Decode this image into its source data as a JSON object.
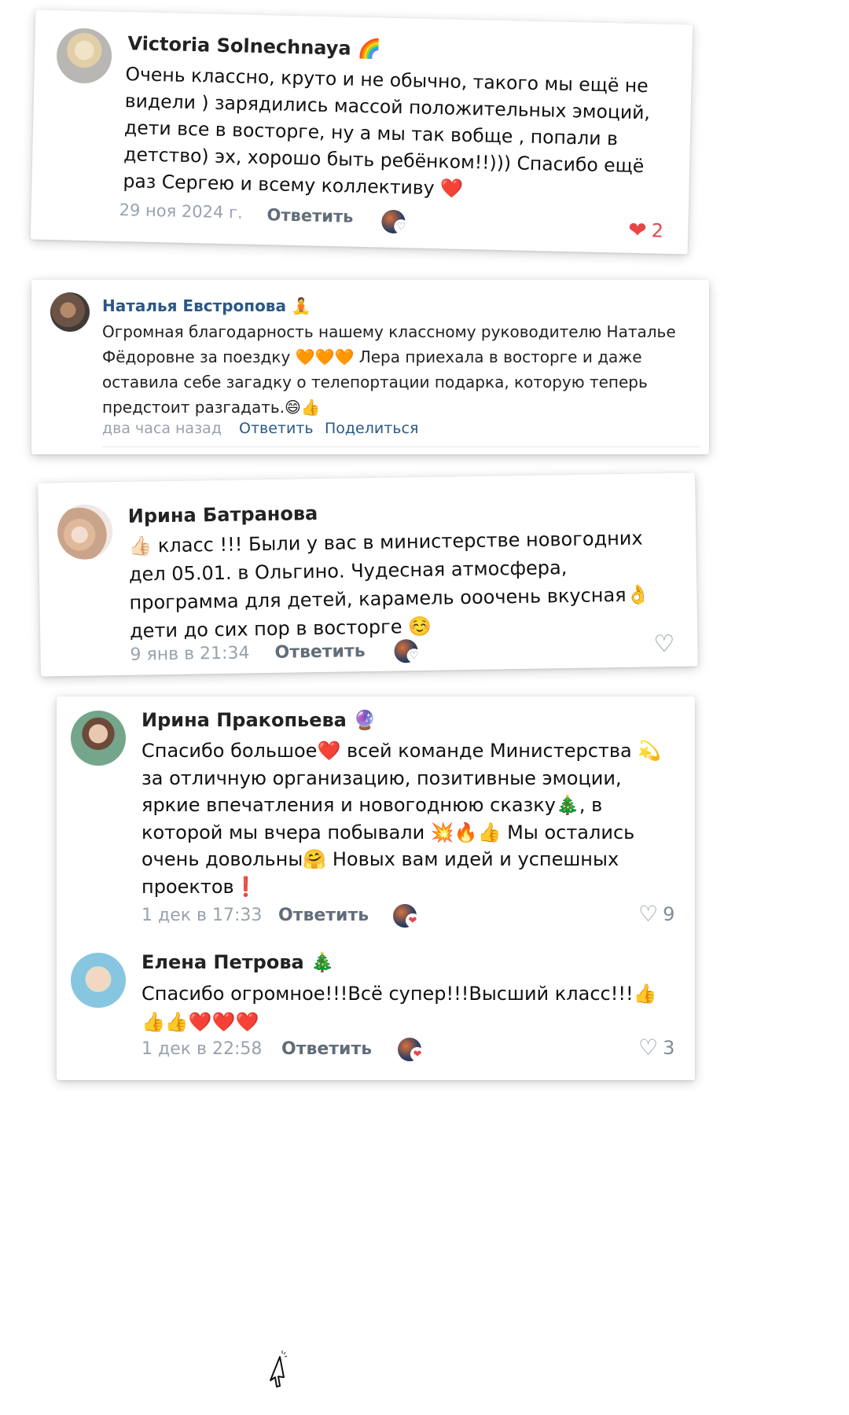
{
  "colors": {
    "like_red": "#e64646",
    "meta_gray": "#99a2ad",
    "link_blue": "#2a5885"
  },
  "comments": [
    {
      "author": "Victoria Solnechnaya 🌈",
      "text": "Очень классно, круто и не обычно,  такого мы ещё не видели ) зарядились массой положительных эмоций, дети все в восторге, ну а мы так вобще , попали в детство) эх, хорошо быть ребёнком!!))) Спасибо ещё раз Сергею и всему коллективу ❤️",
      "date": "29 ноя 2024 г.",
      "reply_label": "Ответить",
      "likes": "2",
      "liked": true
    },
    {
      "author": "Наталья Евстропова 🧘",
      "text": "Огромная благодарность нашему классному руководителю Наталье Фёдоровне за поездку 🧡🧡🧡 Лера приехала в восторге и даже оставила себе загадку о телепортации подарка, которую теперь предстоит разгадать.😄👍",
      "date": "два часа назад",
      "reply_label": "Ответить",
      "share_label": "Поделиться"
    },
    {
      "author": "Ирина Батранова",
      "text": "👍🏻 класс !!! Были у вас в министерстве новогодних дел 05.01. в Ольгино. Чудесная атмосфера, программа для детей, карамель ооочень вкусная👌 дети до сих пор в восторге ☺️",
      "date": "9 янв в 21:34",
      "reply_label": "Ответить"
    },
    {
      "author": "Ирина Пракопьева 🔮",
      "text": "Спасибо большое❤️ всей команде Министерства 💫 за отличную организацию,  позитивные эмоции, яркие впечатления и  новогоднюю сказку🎄, в которой мы вчера побывали 💥🔥👍 Мы остались очень довольны🤗 Новых вам идей и успешных проектов❗",
      "date": "1 дек в 17:33",
      "reply_label": "Ответить",
      "likes": "9"
    },
    {
      "author": "Елена Петрова 🎄",
      "text": "Спасибо огромное!!!Всё супер!!!Высший класс!!!👍👍👍❤️❤️❤️",
      "date": "1 дек в 22:58",
      "reply_label": "Ответить",
      "likes": "3"
    }
  ]
}
